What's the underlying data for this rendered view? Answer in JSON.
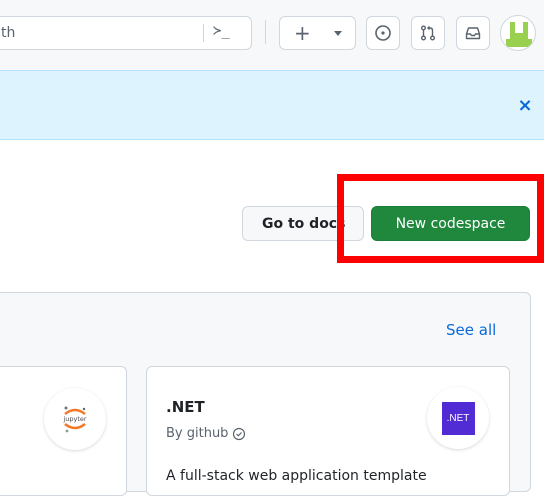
{
  "header": {
    "search_text": "th",
    "command_glyph": "≻_",
    "plus_label": "+",
    "avatar_color": "#9ad04f"
  },
  "banner": {
    "close_label": "×",
    "background": "#ddf4ff"
  },
  "actions": {
    "go_to_docs": "Go to docs",
    "new_codespace": "New codespace",
    "primary_color": "#1f883d",
    "highlight_color": "#ff0000"
  },
  "templates": {
    "see_all": "See all",
    "cards": [
      {
        "name": "",
        "logo_text": "jupyter"
      },
      {
        "name": ".NET",
        "by": "By github",
        "logo_text": ".NET",
        "description": "A full-stack web application template"
      }
    ]
  }
}
